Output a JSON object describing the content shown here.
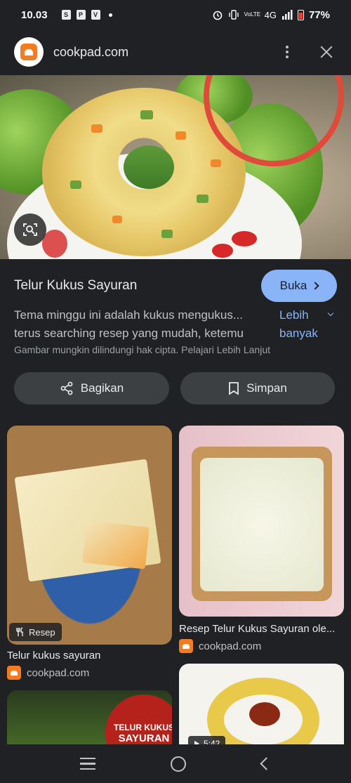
{
  "status_bar": {
    "time": "10.03",
    "network_label": "4G",
    "lte_label": "VoLTE",
    "battery": "77%"
  },
  "header": {
    "site": "cookpad.com",
    "icons": [
      "cookpad-logo-icon",
      "more-vert-icon",
      "close-icon"
    ]
  },
  "result": {
    "title": "Telur Kukus Sayuran",
    "open_label": "Buka",
    "description_line1": "Tema minggu ini adalah kukus mengukus...",
    "description_line2": "terus searching resep yang mudah, ketemu",
    "more_label": "Lebih banyak",
    "copyright": "Gambar mungkin dilindungi hak cipta. Pelajari Lebih Lanjut"
  },
  "actions": {
    "share_label": "Bagikan",
    "save_label": "Simpan"
  },
  "related": [
    {
      "title": "Telur kukus sayuran",
      "source": "cookpad.com",
      "badge": "Resep"
    },
    {
      "title": "Resep Telur Kukus Sayuran ole...",
      "source": "cookpad.com"
    },
    {
      "overlay_text_1": "TELUR KUKUS",
      "overlay_text_2": "SAYURAN"
    },
    {
      "duration": "5:42"
    }
  ],
  "colors": {
    "background": "#202124",
    "accent": "#8ab4f8",
    "button_bg": "#3c4043",
    "brand": "#f47b20"
  }
}
